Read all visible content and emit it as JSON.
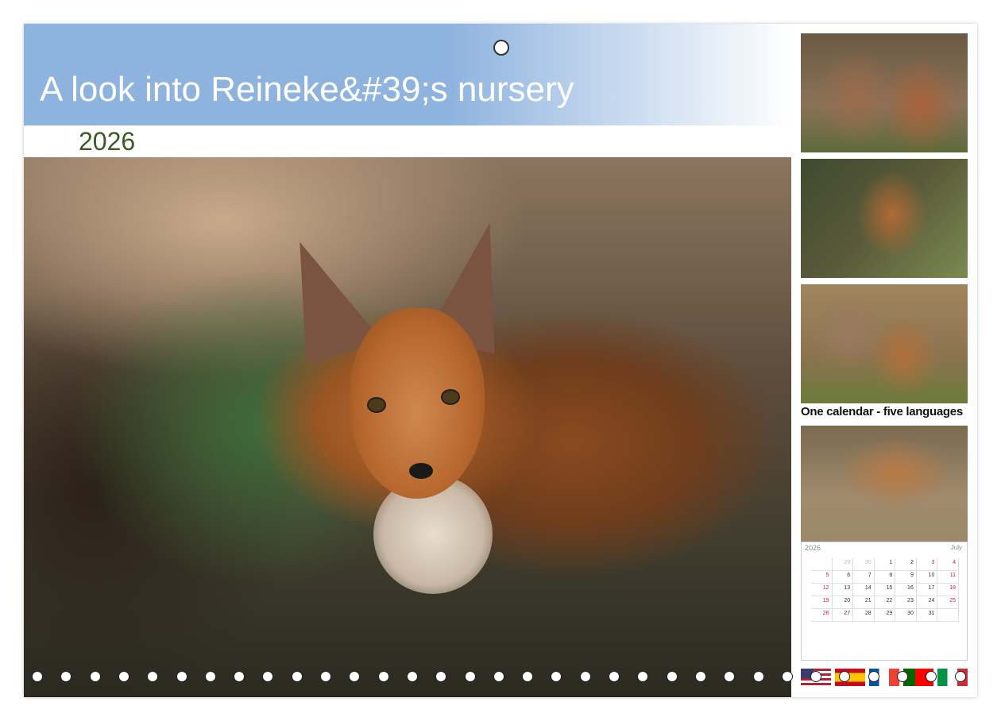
{
  "calendar": {
    "title": "A look into Reineke&#39;s nursery",
    "year": "2026",
    "tagline": "One calendar - five languages",
    "preview": {
      "year": "2026",
      "month": "July",
      "days": [
        [
          "29",
          "30",
          "1",
          "2",
          "3",
          "4"
        ],
        [
          "5",
          "6",
          "7",
          "8",
          "9",
          "10",
          "11"
        ],
        [
          "12",
          "13",
          "14",
          "15",
          "16",
          "17",
          "18"
        ],
        [
          "19",
          "20",
          "21",
          "22",
          "23",
          "24",
          "25"
        ],
        [
          "26",
          "27",
          "28",
          "29",
          "30",
          "31"
        ]
      ]
    },
    "flags": [
      "us-flag-icon",
      "spain-flag-icon",
      "france-flag-icon",
      "portugal-flag-icon",
      "italy-flag-icon"
    ],
    "colors": {
      "title_band": "#8eb3df",
      "year_text": "#3a5a26",
      "title_text": "#ffffff"
    }
  }
}
